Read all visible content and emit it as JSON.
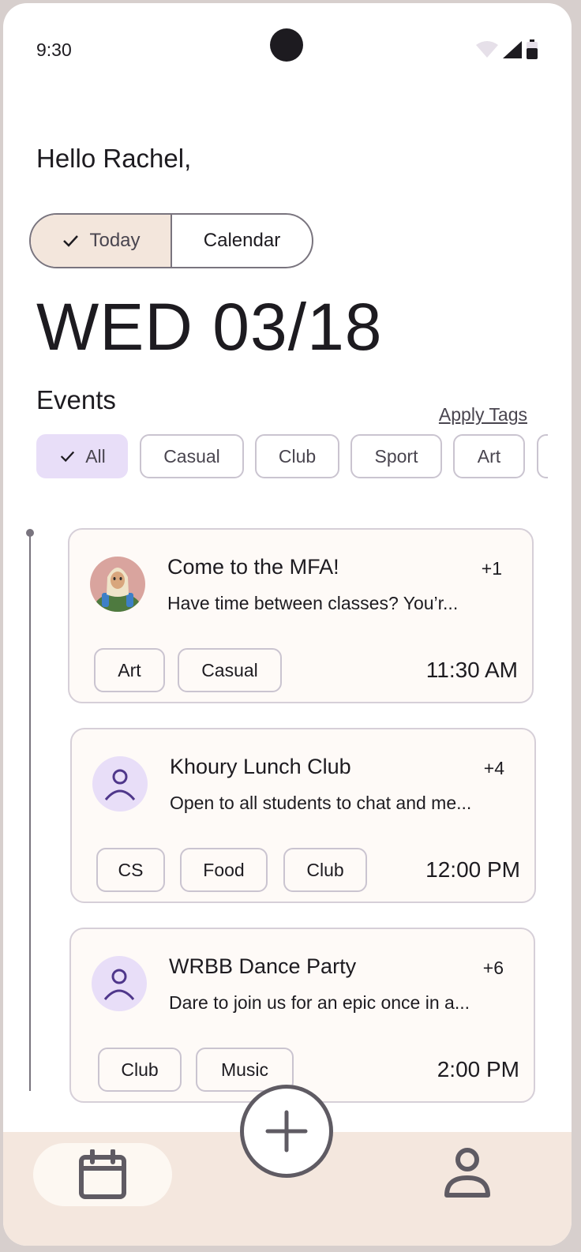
{
  "status_bar": {
    "time": "9:30"
  },
  "greeting": "Hello Rachel,",
  "view_toggle": {
    "today_label": "Today",
    "calendar_label": "Calendar",
    "selected": "Today"
  },
  "date_display": "WED 03/18",
  "events": {
    "title": "Events",
    "apply_tags_label": "Apply Tags",
    "filters": [
      "All",
      "Casual",
      "Club",
      "Sport",
      "Art"
    ],
    "selected_filter": "All"
  },
  "cards": [
    {
      "title": "Come to the MFA!",
      "count": "+1",
      "description": "Have time between classes? You’r...",
      "tags": [
        "Art",
        "Casual"
      ],
      "time": "11:30 AM",
      "avatar": "photo-avatar"
    },
    {
      "title": "Khoury Lunch Club",
      "count": "+4",
      "description": "Open to all students to chat and me...",
      "tags": [
        "CS",
        "Food",
        "Club"
      ],
      "time": "12:00 PM",
      "avatar": "person-icon"
    },
    {
      "title": "WRBB Dance Party",
      "count": "+6",
      "description": "Dare to join us for an epic once in a...",
      "tags": [
        "Club",
        "Music"
      ],
      "time": "2:00 PM",
      "avatar": "person-icon"
    }
  ],
  "nav": {
    "items": [
      "calendar-icon",
      "profile-icon"
    ],
    "fab_icon": "plus-icon"
  },
  "colors": {
    "accent_chip": "#e8def8",
    "nav_bg": "#f4e7de",
    "card_bg": "#fefaf7"
  }
}
